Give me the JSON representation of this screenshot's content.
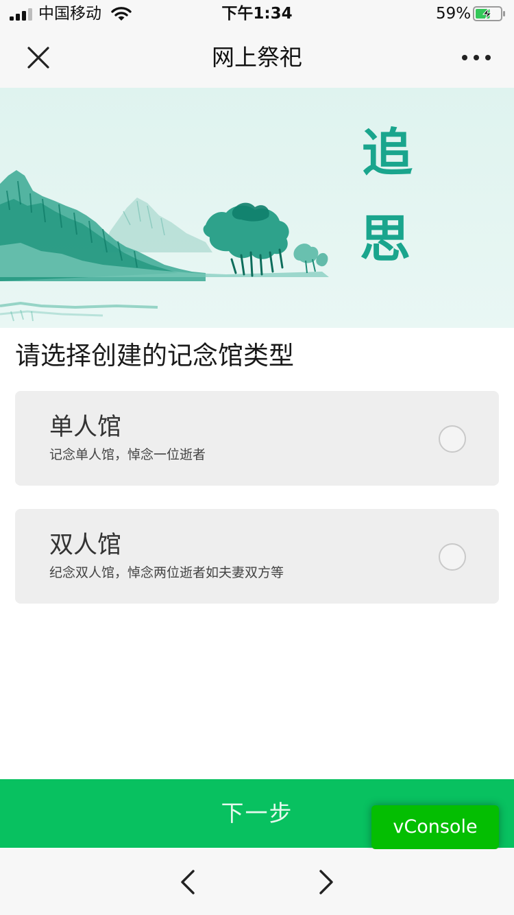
{
  "status_bar": {
    "carrier": "中国移动",
    "time": "下午1:34",
    "battery_percent": "59%",
    "battery_level": 0.59,
    "icons": [
      "signal-icon",
      "wifi-icon",
      "battery-icon"
    ]
  },
  "nav": {
    "title": "网上祭祀",
    "close_icon": "close-icon",
    "more_icon": "more-icon"
  },
  "banner": {
    "calligraphy": [
      "追",
      "思"
    ],
    "accent_color": "#1aa58d",
    "background_color": "#e3f4f1"
  },
  "main": {
    "heading": "请选择创建的记念馆类型",
    "options": [
      {
        "title": "单人馆",
        "description": "记念单人馆，悼念一位逝者",
        "selected": false
      },
      {
        "title": "双人馆",
        "description": "纪念双人馆，悼念两位逝者如夫妻双方等",
        "selected": false
      }
    ]
  },
  "footer": {
    "next_label": "下一步",
    "next_color": "#08c160",
    "vconsole_label": "vConsole",
    "vconsole_color": "#04be02"
  },
  "toolbar": {
    "back_icon": "chevron-left-icon",
    "forward_icon": "chevron-right-icon"
  }
}
